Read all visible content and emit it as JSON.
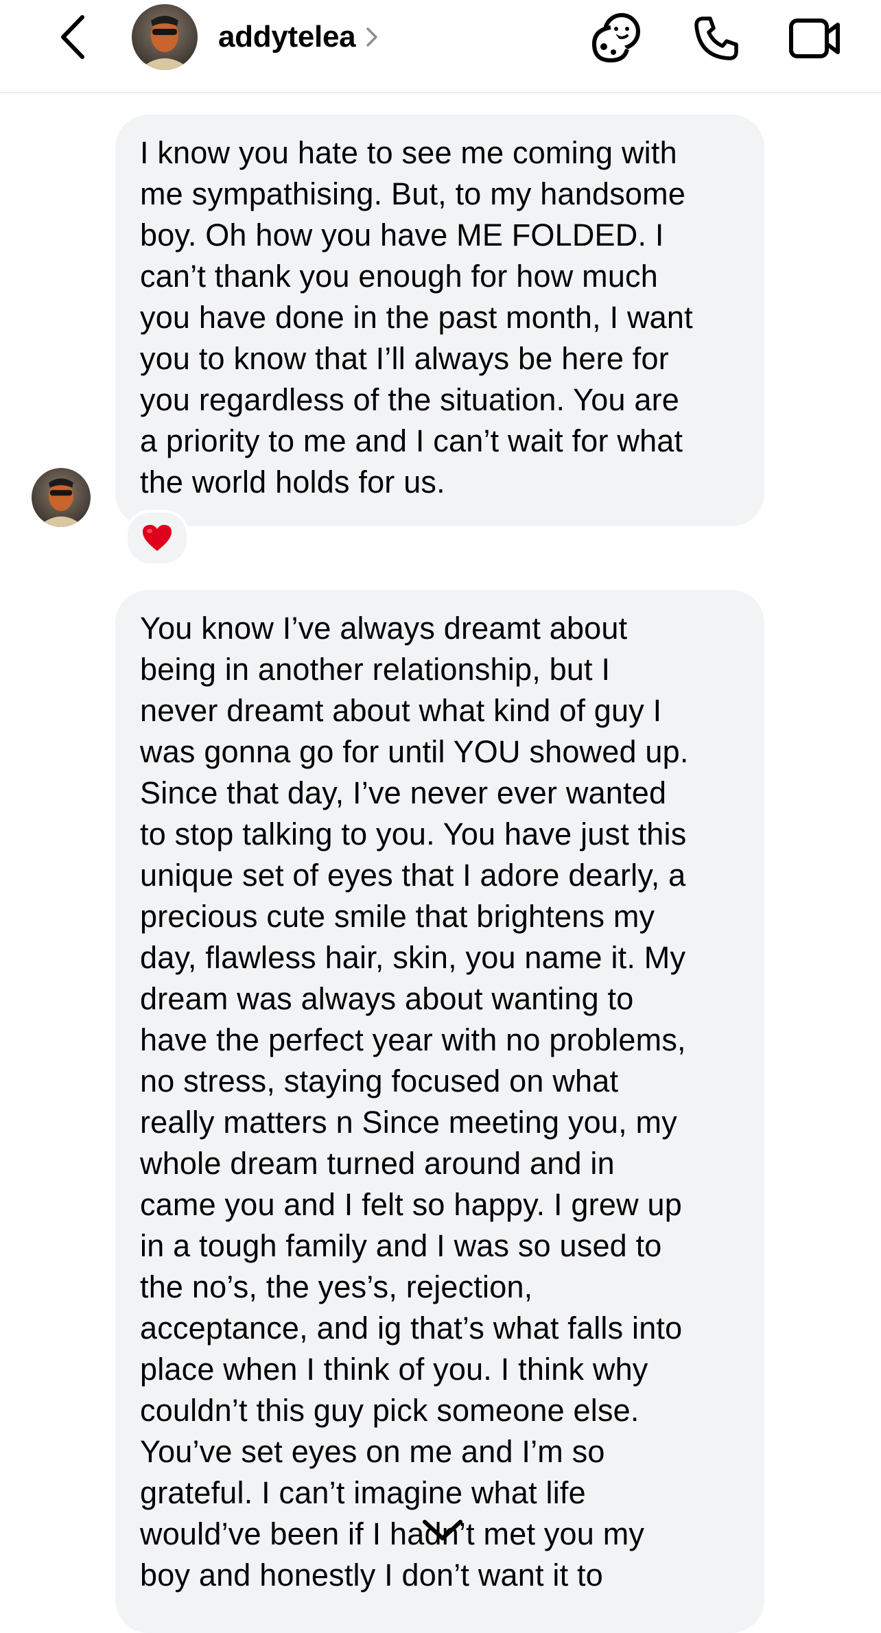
{
  "header": {
    "username": "addytelea",
    "back_icon": "chevron-left-icon",
    "profile_chevron_icon": "chevron-right-icon",
    "actions": [
      {
        "name": "effects-icon"
      },
      {
        "name": "phone-icon"
      },
      {
        "name": "video-camera-icon"
      }
    ]
  },
  "messages": [
    {
      "sender": "addytelea",
      "text": "I know you hate to see me coming with\nme sympathising. But, to my handsome\nboy. Oh how you have ME FOLDED. I\ncan’t thank you enough for how much\nyou have done in the past month, I want\nyou to know that I’ll always be here for\nyou regardless of the situation. You are\na priority to me and I can’t wait for what\nthe world holds for us.",
      "reaction": "❤️"
    },
    {
      "sender": "addytelea",
      "text": "You know I’ve always dreamt about\nbeing in another relationship, but I\nnever dreamt about what kind of guy I\nwas gonna go for until YOU showed up.\nSince that day, I’ve never ever wanted\nto stop talking to you. You have just this\nunique set of eyes that I adore dearly, a\nprecious cute smile that brightens my\nday, flawless hair, skin, you name it. My\ndream was always about wanting to\nhave the perfect year with no problems,\nno stress, staying focused on what\nreally matters n Since meeting you, my\nwhole dream turned around and in\ncame you and I felt so happy. I grew up\nin a tough family and I was so used to\nthe no’s, the yes’s, rejection,\nacceptance, and ig that’s what falls into\nplace when I think of you. I think why\ncouldn’t this guy pick someone else.\nYou’ve set eyes on me and I’m so\ngrateful. I can’t imagine what life\nwould’ve been if I hadn’t met you my\nboy and honestly I don’t want it to"
    }
  ],
  "scroll_down_icon": "chevron-down-icon",
  "colors": {
    "bubble": "#f2f3f5",
    "divider": "#ececec",
    "heart": "#e0001b"
  }
}
